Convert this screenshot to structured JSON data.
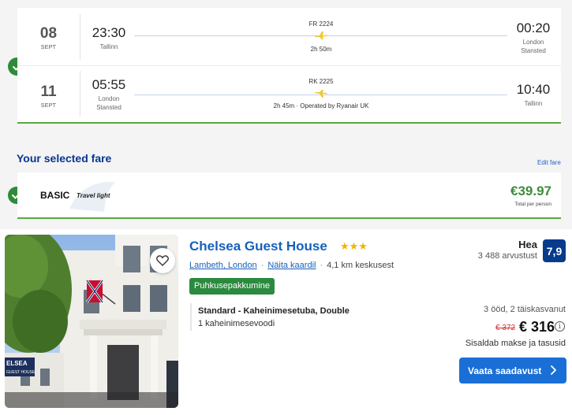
{
  "flights": [
    {
      "day": "08",
      "month": "SEPT",
      "dep_time": "23:30",
      "dep_city": "Tallinn",
      "flight_no": "FR 2224",
      "duration": "2h 50m",
      "arr_time": "00:20",
      "arr_city_1": "London",
      "arr_city_2": "Stansted"
    },
    {
      "day": "11",
      "month": "SEPT",
      "dep_time": "05:55",
      "dep_city_1": "London",
      "dep_city_2": "Stansted",
      "flight_no": "RK 2225",
      "duration": "2h 45m · Operated by Ryanair UK",
      "arr_time": "10:40",
      "arr_city": "Tallinn"
    }
  ],
  "fare": {
    "heading": "Your selected fare",
    "edit_label": "Edit fare",
    "name": "BASIC",
    "tagline": "Travel light",
    "price": "€39.97",
    "per": "Total per person"
  },
  "hotel": {
    "name": "Chelsea Guest House",
    "stars": "★★★",
    "star_count": 3,
    "district": "Lambeth, London",
    "map_link": "Näita kaardil",
    "distance": "4,1 km keskusest",
    "deal_badge": "Puhkusepakkumine",
    "room_type": "Standard - Kaheinimesetuba, Double",
    "bed": "1 kaheinimesevoodi",
    "rating_word": "Hea",
    "reviews": "3 488 arvustust",
    "score": "7,9",
    "stay": "3 ööd, 2 täiskasvanut",
    "old_price": "€ 372",
    "price": "€ 316",
    "taxes": "Sisaldab makse ja tasusid",
    "cta": "Vaata saadavust",
    "photo_sign_1": "ELSEA",
    "photo_sign_2": "GUEST HOUSE"
  },
  "colors": {
    "ryanair_blue": "#073590",
    "ryanair_yellow": "#f1c933",
    "check_green": "#2f8a3a",
    "fare_price_green": "#3b8c3b",
    "hotel_link_blue": "#1560bd",
    "score_bg": "#073b8c",
    "deal_green": "#2b8a3e",
    "cta_blue": "#1a6fd6",
    "old_price_red": "#d32f2f",
    "star_gold": "#f0b400"
  },
  "icons": [
    "check-icon",
    "plane-icon",
    "harp-logo",
    "heart-icon",
    "info-icon",
    "chevron-right-icon"
  ]
}
